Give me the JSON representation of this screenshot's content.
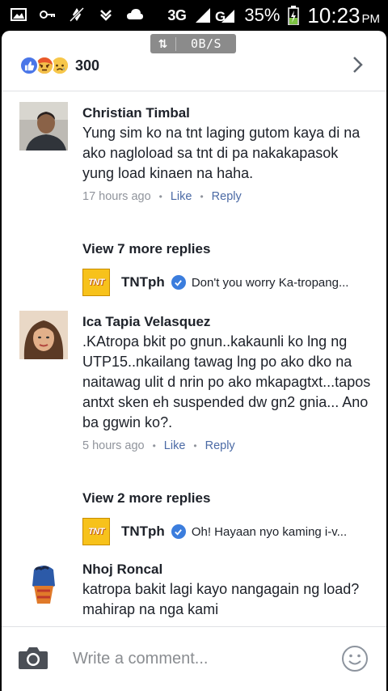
{
  "status_bar": {
    "network": "3G",
    "signal_label": "G",
    "battery": "35%",
    "time": "10:23",
    "ampm": "PM"
  },
  "speed_meter": {
    "arrows": "⇅",
    "rate": "0B/S"
  },
  "reactions": {
    "count": "300",
    "types": [
      "like-icon",
      "angry-icon",
      "sad-icon"
    ]
  },
  "comments": [
    {
      "name": "Christian Timbal",
      "text": "Yung sim ko na tnt laging gutom kaya di na ako nagloload sa tnt di pa nakakapasok yung load kinaen na haha.",
      "time": "17 hours ago",
      "like": "Like",
      "reply": "Reply",
      "more_replies": "View 7 more replies",
      "latest_reply": {
        "name": "TNTph",
        "text": "Don't you worry Ka-tropang..."
      }
    },
    {
      "name": "Ica Tapia Velasquez",
      "text": ".KAtropa bkit po gnun..kakaunli ko lng ng UTP15..nkailang tawag lng po ako dko na naitawag ulit d nrin po ako mkapagtxt...tapos antxt sken eh suspended dw gn2 gnia... Ano ba ggwin ko?.",
      "time": "5 hours ago",
      "like": "Like",
      "reply": "Reply",
      "more_replies": "View 2 more replies",
      "latest_reply": {
        "name": "TNTph",
        "text": "Oh! Hayaan nyo kaming i-v..."
      }
    },
    {
      "name": "Nhoj Roncal",
      "text": "katropa bakit lagi kayo nangagain ng load? mahirap na nga kami"
    }
  ],
  "tnt_logo_text": "TNT",
  "composer": {
    "placeholder": "Write a comment..."
  },
  "colors": {
    "link": "#4b6aa5",
    "verified": "#3b7ddd",
    "like": "#4a76e8",
    "tnt": "#f7c21b"
  }
}
